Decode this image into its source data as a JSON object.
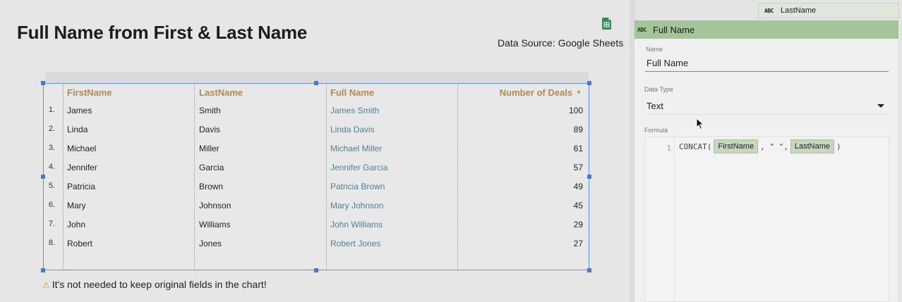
{
  "report": {
    "title": "Full Name from First & Last Name",
    "data_source": "Data Source: Google Sheets",
    "note": "It's not needed to keep original fields in the chart!"
  },
  "table": {
    "columns": [
      "FirstName",
      "LastName",
      "Full Name",
      "Number of Deals"
    ],
    "rows": [
      {
        "n": "1.",
        "first": "James",
        "last": "Smith",
        "full": "James Smith",
        "deals": "100"
      },
      {
        "n": "2.",
        "first": "Linda",
        "last": "Davis",
        "full": "Linda Davis",
        "deals": "89"
      },
      {
        "n": "3.",
        "first": "Michael",
        "last": "Miller",
        "full": "Michael Miller",
        "deals": "61"
      },
      {
        "n": "4.",
        "first": "Jennifer",
        "last": "Garcia",
        "full": "Jennifer Garcia",
        "deals": "57"
      },
      {
        "n": "5.",
        "first": "Patricia",
        "last": "Brown",
        "full": "Patricia Brown",
        "deals": "49"
      },
      {
        "n": "6.",
        "first": "Mary",
        "last": "Johnson",
        "full": "Mary Johnson",
        "deals": "45"
      },
      {
        "n": "7.",
        "first": "John",
        "last": "Williams",
        "full": "John Williams",
        "deals": "29"
      },
      {
        "n": "8.",
        "first": "Robert",
        "last": "Jones",
        "full": "Robert Jones",
        "deals": "27"
      }
    ],
    "sort_icon": "sort-descending-icon",
    "colors": {
      "header": "#b08a52",
      "computed_field": "#4f7f96",
      "selection": "#4a76d0"
    }
  },
  "panel": {
    "top_field_label": "LastName",
    "type_badge": "ABC",
    "header_label": "Full Name",
    "name_label": "Name",
    "name_value": "Full Name",
    "data_type_label": "Data Type",
    "data_type_value": "Text",
    "formula_label": "Formula",
    "line_number": "1",
    "formula": {
      "fn_open": "CONCAT(",
      "arg1": "FirstName",
      "sep": ", \" \",",
      "arg2": "LastName",
      "close": ")"
    },
    "header_color": "#a6c49a"
  }
}
